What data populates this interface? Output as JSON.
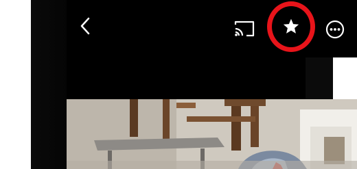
{
  "topbar": {
    "icons": [
      "back-chevron-icon",
      "cast-icon",
      "star-icon",
      "more-options-icon"
    ],
    "highlight_color": "#e8141a"
  },
  "photo": {
    "description_icons": [
      "photo-thumbnail"
    ]
  }
}
